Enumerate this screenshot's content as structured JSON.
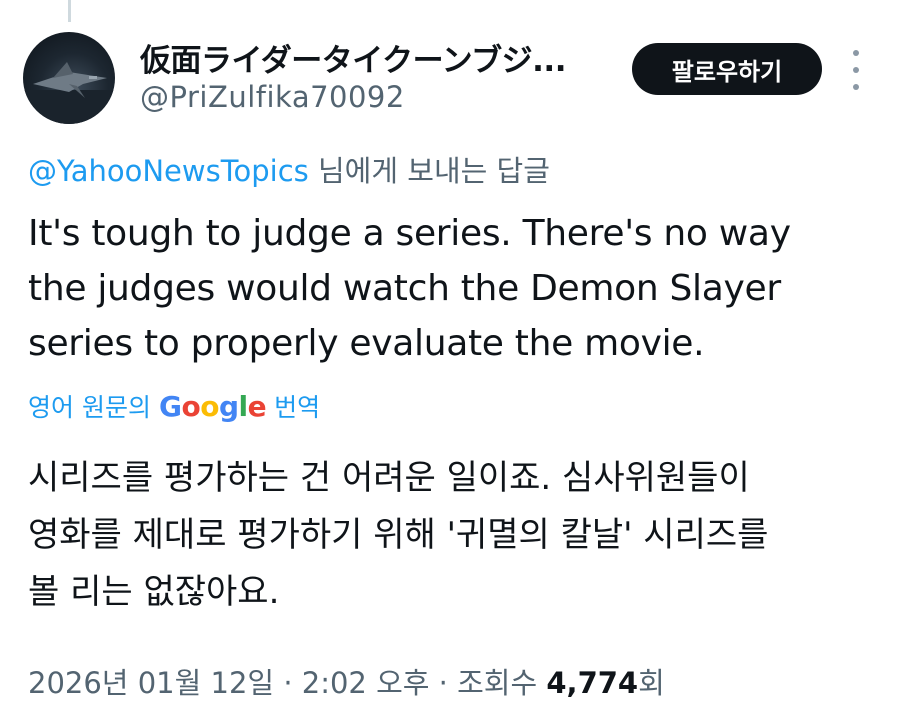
{
  "author": {
    "display_name": "仮面ライダータイクーンブジ...",
    "handle": "@PriZulfika70092",
    "avatar_icon": "fighter-jet-avatar"
  },
  "follow_button": {
    "label": "팔로우하기"
  },
  "more_menu": {
    "icon": "more-vertical-icon"
  },
  "reply_context": {
    "mention": "@YahooNewsTopics",
    "suffix": "님에게 보내는 답글"
  },
  "tweet": {
    "lines": [
      "It's tough to judge a series. There's no way",
      "the judges would watch the Demon Slayer",
      "series to properly evaluate the movie."
    ]
  },
  "translation": {
    "prefix": "영어 원문의",
    "provider": "Google",
    "suffix": "번역",
    "lines": [
      "시리즈를 평가하는 건 어려운 일이죠. 심사위원들이",
      "영화를 제대로 평가하기 위해 '귀멸의 칼날' 시리즈를",
      "볼 리는 없잖아요."
    ]
  },
  "meta": {
    "date": "2026년 01월 12일",
    "separator": "·",
    "time": "2:02 오후",
    "views_label": "조회수",
    "views_count": "4,774",
    "views_unit": "회"
  },
  "colors": {
    "link": "#1d9bf0",
    "secondary": "#536471",
    "button_bg": "#0f1419"
  }
}
